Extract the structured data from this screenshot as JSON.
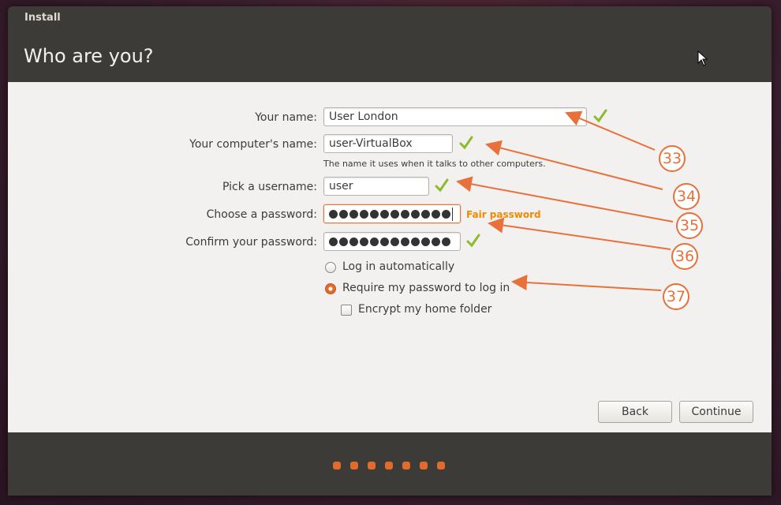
{
  "window": {
    "title": "Install"
  },
  "page": {
    "heading": "Who are you?"
  },
  "form": {
    "name_label": "Your name:",
    "name_value": "User London",
    "computer_label": "Your computer's name:",
    "computer_value": "user-VirtualBox",
    "computer_hint": "The name it uses when it talks to other computers.",
    "username_label": "Pick a username:",
    "username_value": "user",
    "password_label": "Choose a password:",
    "password_dots": 12,
    "password_strength": "Fair password",
    "confirm_label": "Confirm your password:",
    "confirm_dots": 12,
    "login_auto_label": "Log in automatically",
    "login_require_label": "Require my password to log in",
    "encrypt_label": "Encrypt my home folder",
    "selected_login_option": "require_password",
    "encrypt_checked": false
  },
  "buttons": {
    "back": "Back",
    "continue": "Continue"
  },
  "progress": {
    "steps": 7
  },
  "callouts": [
    "33",
    "34",
    "35",
    "36",
    "37"
  ],
  "colors": {
    "accent": "#e06b2d",
    "valid": "#8cbc2a",
    "annotation": "#e8703a",
    "strength": "#f08a00"
  },
  "icons": {
    "valid": "checkmark-icon",
    "cursor": "mouse-pointer-icon"
  }
}
